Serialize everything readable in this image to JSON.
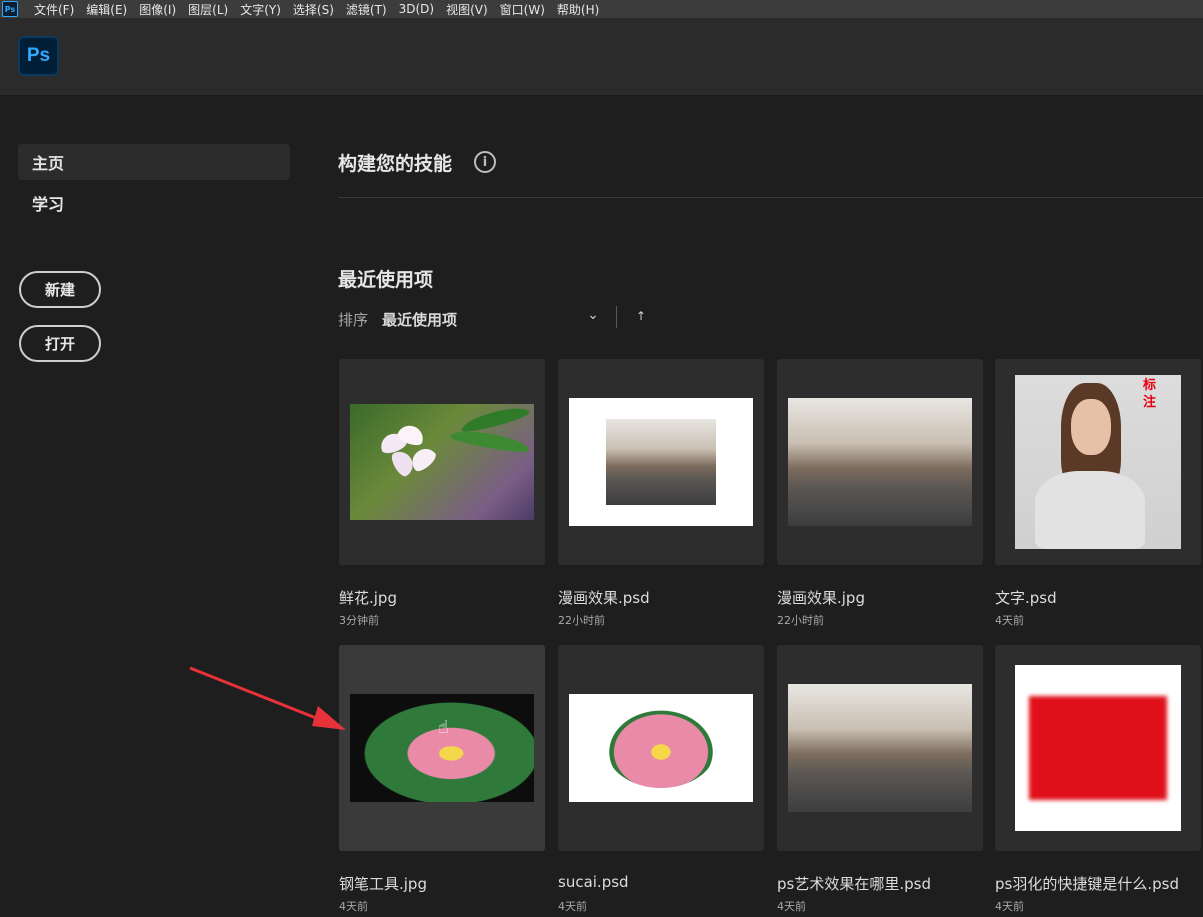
{
  "app": {
    "icon_text": "Ps",
    "logo_text": "Ps"
  },
  "menubar": {
    "items": [
      "文件(F)",
      "编辑(E)",
      "图像(I)",
      "图层(L)",
      "文字(Y)",
      "选择(S)",
      "滤镜(T)",
      "3D(D)",
      "视图(V)",
      "窗口(W)",
      "帮助(H)"
    ]
  },
  "sidebar": {
    "nav": [
      {
        "label": "主页",
        "active": true
      },
      {
        "label": "学习",
        "active": false
      }
    ],
    "buttons": {
      "new_label": "新建",
      "open_label": "打开"
    }
  },
  "main": {
    "skills_title": "构建您的技能",
    "info_icon": "info-icon",
    "recent_title": "最近使用项",
    "sort_label": "排序",
    "sort_value": "最近使用项",
    "sort_chevron": "⌄",
    "sort_up": "↑"
  },
  "files": [
    {
      "name": "鲜花.jpg",
      "time": "3分钟前"
    },
    {
      "name": "漫画效果.psd",
      "time": "22小时前"
    },
    {
      "name": "漫画效果.jpg",
      "time": "22小时前"
    },
    {
      "name": "文字.psd",
      "time": "4天前",
      "overlay_text": "标注"
    },
    {
      "name": "钢笔工具.jpg",
      "time": "4天前"
    },
    {
      "name": "sucai.psd",
      "time": "4天前"
    },
    {
      "name": "ps艺术效果在哪里.psd",
      "time": "4天前"
    },
    {
      "name": "ps羽化的快捷键是什么.psd",
      "time": "4天前"
    }
  ],
  "colors": {
    "ps_blue": "#31a8ff",
    "bg": "#1e1e1e",
    "annotation_red": "#e8323a"
  }
}
